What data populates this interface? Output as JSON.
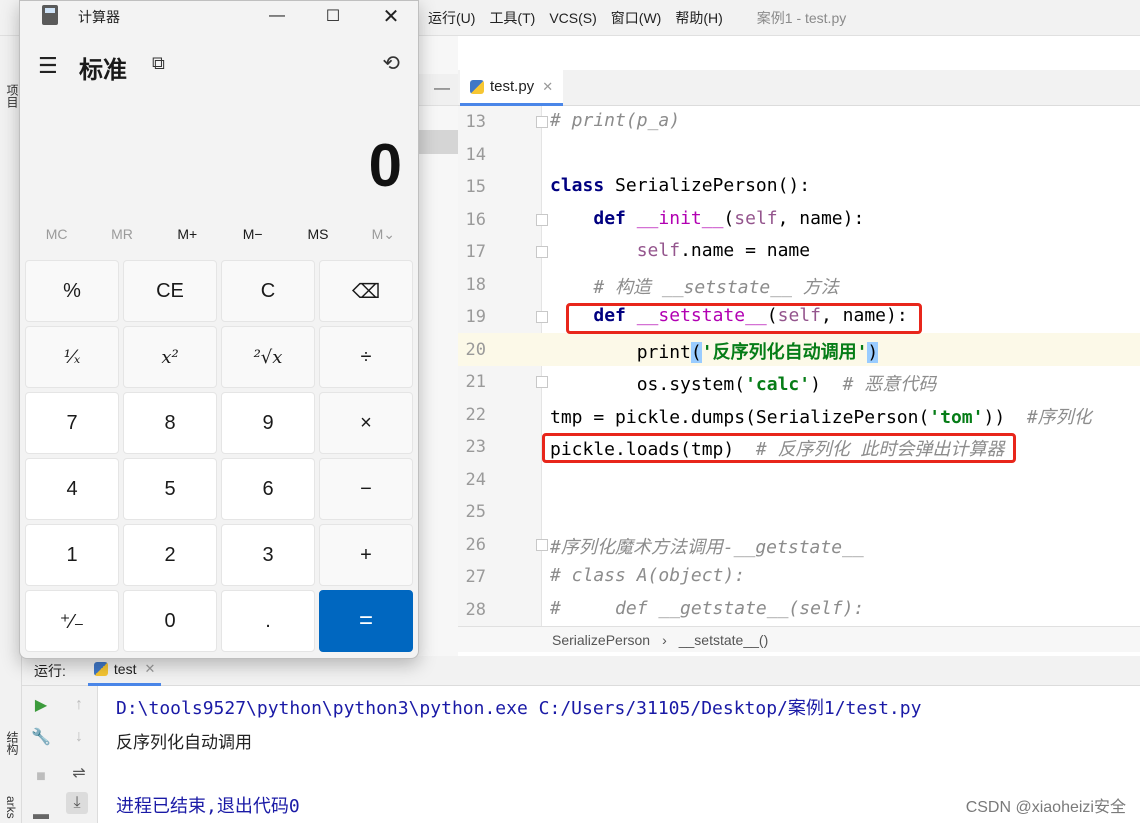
{
  "ide": {
    "menus": [
      "运行(U)",
      "工具(T)",
      "VCS(S)",
      "窗口(W)",
      "帮助(H)"
    ],
    "window_title": "案例1 - test.py",
    "left_strip": {
      "project": "项目",
      "structure": "结构",
      "bookmarks": "arks"
    },
    "editor_tab": "test.py",
    "line_numbers": [
      "13",
      "14",
      "15",
      "16",
      "17",
      "18",
      "19",
      "20",
      "21",
      "22",
      "23",
      "24",
      "25",
      "26",
      "27",
      "28"
    ],
    "breadcrumb": {
      "class": "SerializePerson",
      "method": "__setstate__()"
    },
    "run": {
      "label": "运行:",
      "tab": "test",
      "command": "D:\\tools9527\\python\\python3\\python.exe C:/Users/31105/Desktop/案例1/test.py",
      "output": "反序列化自动调用",
      "exit": "进程已结束,退出代码0"
    },
    "watermark": "CSDN @xiaoheizi安全"
  },
  "calculator": {
    "title": "计算器",
    "mode": "标准",
    "display": "0",
    "memory": [
      "MC",
      "MR",
      "M+",
      "M−",
      "MS",
      "M⌄"
    ],
    "keys": [
      "%",
      "CE",
      "C",
      "⌫",
      "¹⁄ₓ",
      "x²",
      "²√x",
      "÷",
      "7",
      "8",
      "9",
      "×",
      "4",
      "5",
      "6",
      "−",
      "1",
      "2",
      "3",
      "+",
      "⁺⁄₋",
      "0",
      ".",
      "="
    ]
  }
}
